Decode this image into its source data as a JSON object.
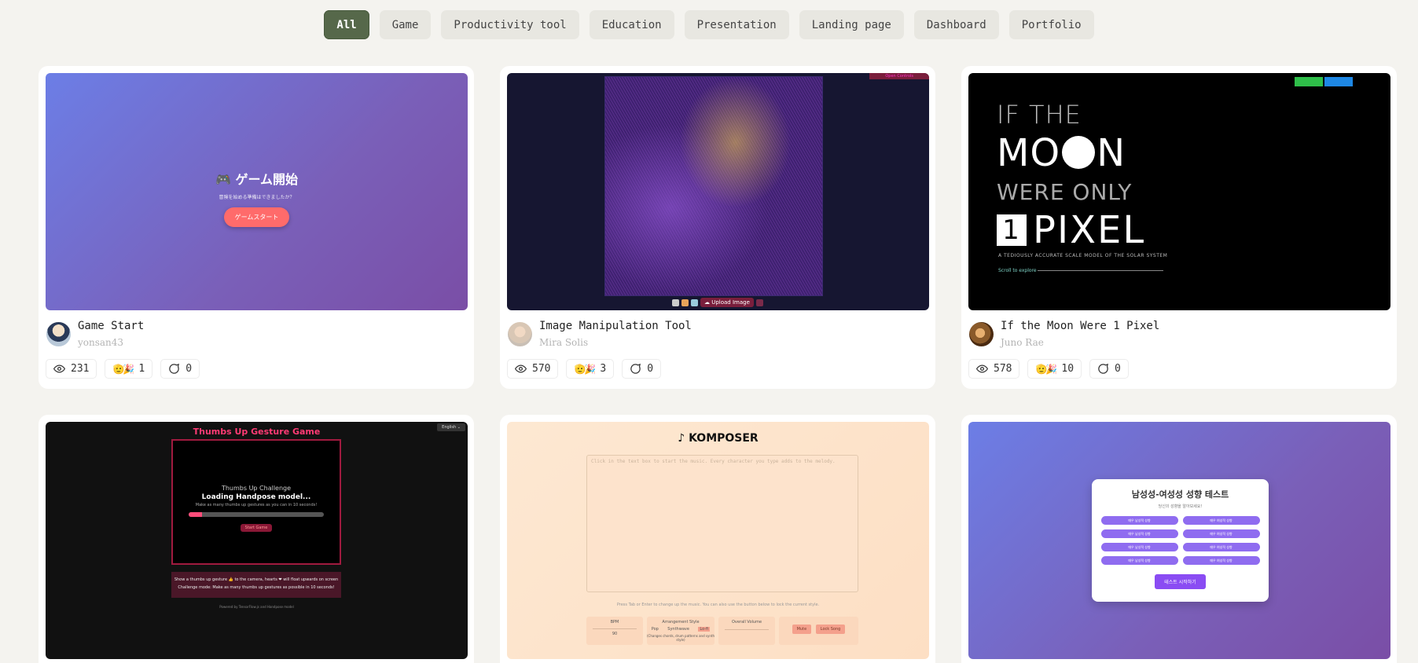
{
  "filters": [
    {
      "label": "All",
      "active": true
    },
    {
      "label": "Game",
      "active": false
    },
    {
      "label": "Productivity tool",
      "active": false
    },
    {
      "label": "Education",
      "active": false
    },
    {
      "label": "Presentation",
      "active": false
    },
    {
      "label": "Landing page",
      "active": false
    },
    {
      "label": "Dashboard",
      "active": false
    },
    {
      "label": "Portfolio",
      "active": false
    }
  ],
  "cards": [
    {
      "title": "Game Start",
      "author": "yonsan43",
      "views": "231",
      "reactions": "1",
      "comments": "0",
      "thumb": {
        "heading": "🎮 ゲーム開始",
        "sub": "冒険を始める準備はできましたか？",
        "button": "ゲームスタート"
      }
    },
    {
      "title": "Image Manipulation Tool",
      "author": "Mira Solis",
      "views": "570",
      "reactions": "3",
      "comments": "0",
      "thumb": {
        "tag": "Open Controls",
        "upload": "☁ Upload Image"
      }
    },
    {
      "title": "If the Moon Were 1 Pixel",
      "author": "Juno Rae",
      "views": "578",
      "reactions": "10",
      "comments": "0",
      "thumb": {
        "line1": "IF THE",
        "line2a": "MO",
        "line2b": "N",
        "line3": "WERE ONLY",
        "digit": "1",
        "line4": "PIXEL",
        "sub": "A TEDIOUSLY ACCURATE SCALE MODEL OF THE SOLAR SYSTEM",
        "scroll": "Scroll to explore"
      }
    },
    {
      "thumb": {
        "title": "Thumbs Up Gesture Game",
        "lang": "English ⌄",
        "challenge": "Thumbs Up Challenge",
        "loading": "Loading Handpose model...",
        "hint": "Make as many thumbs up gestures as you can in 10 seconds!",
        "start": "Start Game",
        "info1": "Show a thumbs up gesture 👍 to the camera, hearts ❤ will float upwards on screen",
        "info2": "Challenge mode: Make as many thumbs up gestures as possible in 10 seconds!",
        "powered": "Powered by TensorFlow.js and Handpose model",
        "progress": 0.1
      }
    },
    {
      "thumb": {
        "logo": "♪ KOMPOSER",
        "placeholder": "Click in the text box to start the music. Every character you type adds to the melody.",
        "hint": "Press Tab or Enter to change up the music. You can also use the button below to lock the current style.",
        "bpm": "BPM",
        "bpm_value": "90",
        "style": "Arrangement Style",
        "styles": [
          "Pop",
          "Synthwave",
          "Lo-fi"
        ],
        "style_note": "(Changes chords, drum patterns and synth style)",
        "volume": "Overall Volume",
        "mute": "Mute",
        "lock": "Lock Song"
      }
    },
    {
      "thumb": {
        "heading": "남성성-여성성 성향 테스트",
        "sub": "당신의 성향을 알아보세요!",
        "options": [
          "매우 남성적 성향",
          "매우 여성적 성향",
          "매우 남성적 성향",
          "매우 여성적 성향",
          "매우 남성적 성향",
          "매우 여성적 성향",
          "매우 남성적 성향",
          "매우 여성적 성향"
        ],
        "button": "테스트 시작하기"
      }
    }
  ]
}
